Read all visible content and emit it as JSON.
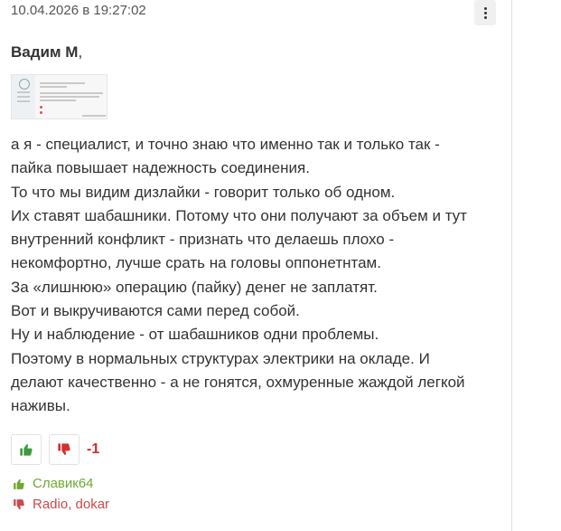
{
  "comment": {
    "timestamp": "10.04.2026 в 19:27:02",
    "quoted_author": "Вадим М",
    "quoted_author_suffix": ",",
    "lines": [
      "а я - специалист, и точно знаю что именно так и только так -",
      "пайка повышает надежность соединения.",
      "То что мы видим дизлайки - говорит только об одном.",
      "Их ставят шабашники. Потому что они получают за объем и тут",
      "внутренний конфликт - признать что делаешь плохо -",
      "некомфортно, лучше срать на головы оппонетнтам.",
      "За «лишнюю» операцию (пайку) денег не заплатят.",
      "Вот и выкручиваются сами перед собой.",
      "Ну и наблюдение - от шабашников одни проблемы.",
      "Поэтому в нормальных структурах электрики на окладе. И",
      "делают качественно - а не гонятся, охмуренные жаждой легкой",
      "наживы."
    ],
    "score": "-1",
    "liked_by": "Славик64",
    "disliked_by": "Radio, dokar"
  },
  "colors": {
    "like_green": "#4caf50",
    "dislike_red": "#d32f2f",
    "score_red": "#d42a2a",
    "liked_by_green": "#6fa832",
    "disliked_by_red": "#c94b4b"
  },
  "icons": {
    "menu": "more-vertical-icon",
    "like": "thumbs-up-icon",
    "dislike": "thumbs-down-icon"
  }
}
